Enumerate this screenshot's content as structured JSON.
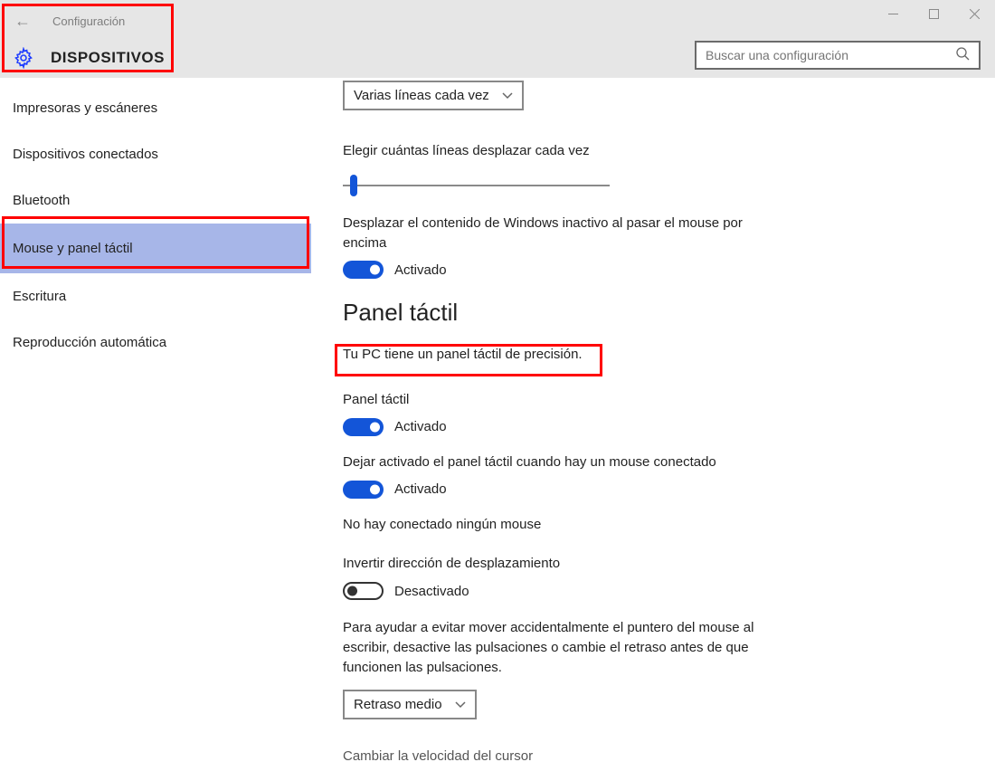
{
  "header": {
    "title": "Configuración",
    "category": "DISPOSITIVOS",
    "search_placeholder": "Buscar una configuración"
  },
  "sidebar": {
    "items": [
      {
        "label": "Impresoras y escáneres"
      },
      {
        "label": "Dispositivos conectados"
      },
      {
        "label": "Bluetooth"
      },
      {
        "label": "Mouse y panel táctil",
        "selected": true
      },
      {
        "label": "Escritura"
      },
      {
        "label": "Reproducción automática"
      }
    ]
  },
  "content": {
    "scroll_dropdown": "Varias líneas cada vez",
    "lines_label": "Elegir cuántas líneas desplazar cada vez",
    "slider_percent": 4,
    "inactive_scroll": {
      "label": "Desplazar el contenido de Windows inactivo al pasar el mouse por encima",
      "state": "Activado",
      "on": true
    },
    "section_title": "Panel táctil",
    "precision_msg": "Tu PC tiene un panel táctil de precisión.",
    "touchpad": {
      "label": "Panel táctil",
      "state": "Activado",
      "on": true
    },
    "leave_on": {
      "label": "Dejar activado el panel táctil cuando hay un mouse conectado",
      "state": "Activado",
      "on": true
    },
    "no_mouse_msg": "No hay conectado ningún mouse",
    "invert": {
      "label": "Invertir dirección de desplazamiento",
      "state": "Desactivado",
      "on": false
    },
    "help_text": "Para ayudar a evitar mover accidentalmente el puntero del mouse al escribir, desactive las pulsaciones o cambie el retraso antes de que funcionen las pulsaciones.",
    "delay_dropdown": "Retraso medio",
    "cursor_speed_label": "Cambiar la velocidad del cursor"
  }
}
